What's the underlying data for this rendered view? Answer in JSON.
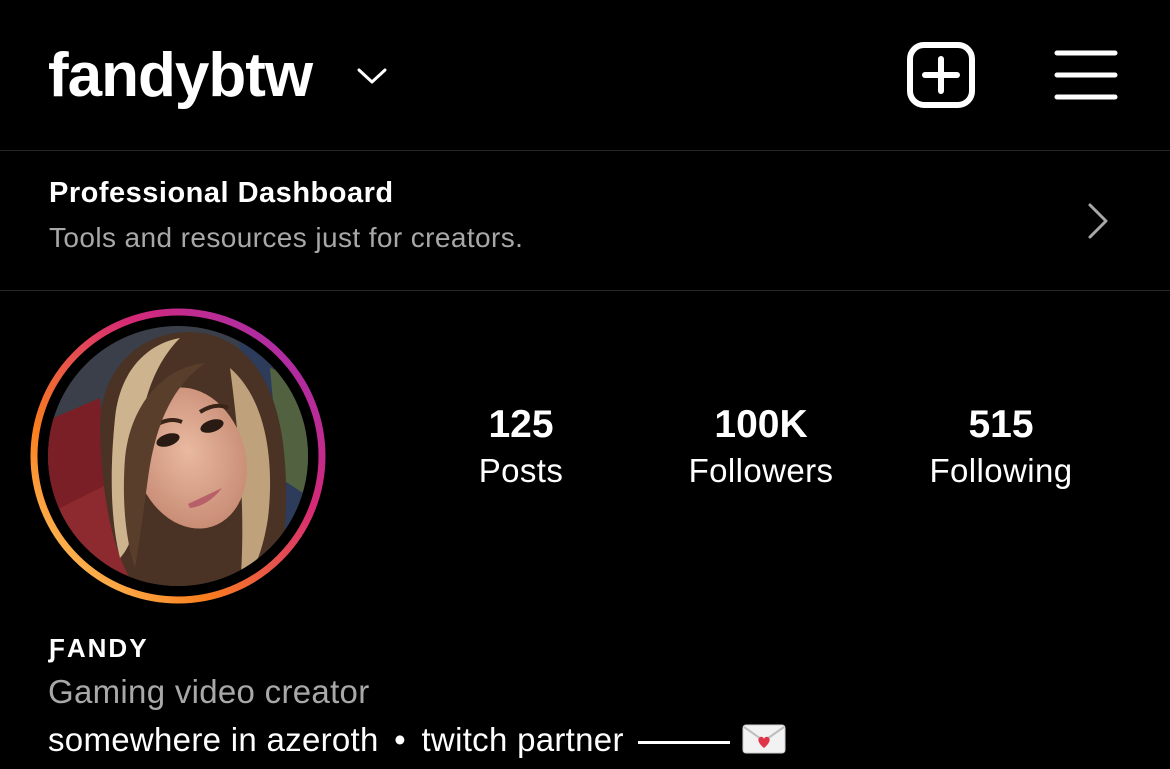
{
  "header": {
    "username": "fandybtw",
    "username_chevron_icon": "chevron-down-icon",
    "add_icon": "plus-square-icon",
    "menu_icon": "hamburger-menu-icon"
  },
  "dashboard": {
    "title": "Professional Dashboard",
    "subtitle": "Tools and resources just for creators.",
    "chevron_icon": "chevron-right-icon"
  },
  "profile": {
    "avatar_ring_colors": [
      "#feda75",
      "#fa7e1e",
      "#d62976",
      "#962fbf"
    ],
    "stats": [
      {
        "value": "125",
        "label": "Posts"
      },
      {
        "value": "100K",
        "label": "Followers"
      },
      {
        "value": "515",
        "label": "Following"
      }
    ],
    "display_name": "ƑANDY",
    "category": "Gaming video creator",
    "bio": {
      "location": "somewhere in azeroth",
      "separator": "•",
      "role": "twitch partner",
      "emoji_icon": "love-letter-icon"
    }
  }
}
